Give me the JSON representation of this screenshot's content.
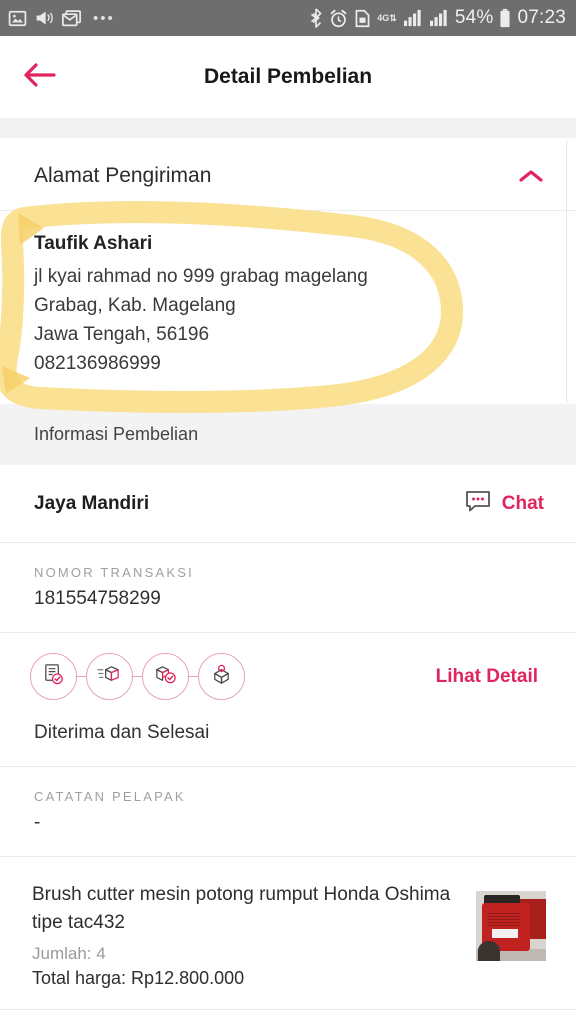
{
  "status_bar": {
    "left_icons": [
      "image-icon",
      "megaphone-icon",
      "mail-icon",
      "more-dots-icon"
    ],
    "right_icons": [
      "bluetooth-icon",
      "alarm-icon",
      "sim-card-icon",
      "network-4g-icon",
      "signal-bars-icon",
      "signal-bars-2-icon",
      "battery-icon"
    ],
    "network": "4G",
    "battery_percent": "54%",
    "time": "07:23"
  },
  "header": {
    "title": "Detail Pembelian",
    "back_icon": "arrow-left-icon"
  },
  "address_section": {
    "title": "Alamat Pengiriman",
    "collapse_icon": "chevron-up-icon",
    "recipient_name": "Taufik Ashari",
    "street": "jl kyai rahmad no 999 grabag magelang",
    "district": "Grabag, Kab. Magelang",
    "province_postal": "Jawa Tengah, 56196",
    "phone": "082136986999"
  },
  "purchase_info": {
    "section_title": "Informasi Pembelian",
    "shop_name": "Jaya Mandiri",
    "chat_label": "Chat",
    "chat_icon": "chat-bubble-icon",
    "transaction_label": "NOMOR TRANSAKSI",
    "transaction_number": "181554758299",
    "steps": [
      {
        "icon": "invoice-paid-icon",
        "name": "order-placed"
      },
      {
        "icon": "package-shipping-icon",
        "name": "shipping"
      },
      {
        "icon": "package-delivered-icon",
        "name": "delivered"
      },
      {
        "icon": "package-opened-icon",
        "name": "completed"
      }
    ],
    "detail_link": "Lihat Detail",
    "status_text": "Diterima dan Selesai",
    "note_label": "CATATAN PELAPAK",
    "note_value": "-"
  },
  "product": {
    "title": "Brush cutter mesin potong rumput Honda Oshima tipe tac432",
    "quantity": "Jumlah: 4",
    "total_price": "Total harga: Rp12.800.000",
    "thumbnail": "product-photo"
  },
  "annotation": {
    "type": "highlighter-circle",
    "color": "#fbdf8e",
    "target": "address-block"
  },
  "colors": {
    "accent": "#e0245e",
    "status_bar_bg": "#6e6e6e",
    "band_bg": "#f3f3f4",
    "highlight": "#fbdf8e"
  }
}
